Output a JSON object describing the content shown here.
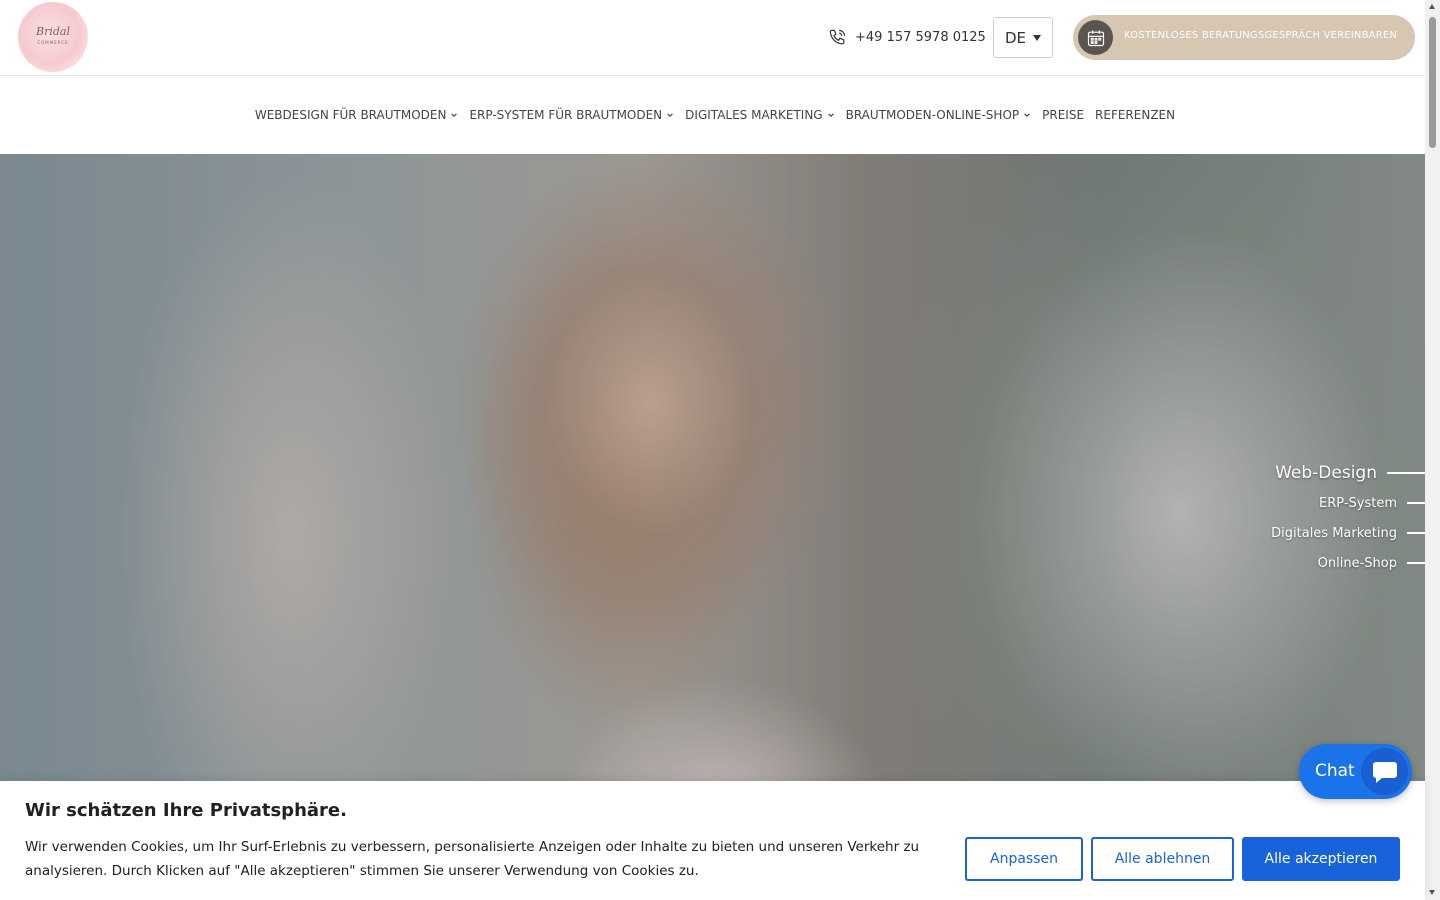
{
  "header": {
    "logo": {
      "script": "Bridal",
      "sub": "COMMERCE",
      "icon": "bridal-commerce-logo"
    },
    "phone": {
      "icon": "phone-icon",
      "number": "+49 157 5978 0125"
    },
    "language": {
      "selected": "DE"
    },
    "cta": {
      "icon": "calendar-icon",
      "label": "KOSTENLOSES BERATUNGSGESPRÄCH VEREINBAREN"
    }
  },
  "nav": {
    "items": [
      {
        "label": "WEBDESIGN FÜR BRAUTMODEN",
        "dropdown": true
      },
      {
        "label": "ERP-SYSTEM FÜR BRAUTMODEN",
        "dropdown": true
      },
      {
        "label": "DIGITALES MARKETING",
        "dropdown": true
      },
      {
        "label": "BRAUTMODEN-ONLINE-SHOP",
        "dropdown": true
      },
      {
        "label": "PREISE",
        "dropdown": false
      },
      {
        "label": "REFERENZEN",
        "dropdown": false
      }
    ]
  },
  "hero": {
    "side_nav": [
      {
        "label": "Web-Design",
        "active": true
      },
      {
        "label": "ERP-System",
        "active": false
      },
      {
        "label": "Digitales Marketing",
        "active": false
      },
      {
        "label": "Online-Shop",
        "active": false
      }
    ]
  },
  "chat": {
    "label": "Chat",
    "icon": "chat-bubble-icon"
  },
  "cookie": {
    "title": "Wir schätzen Ihre Privatsphäre.",
    "text": "Wir verwenden Cookies, um Ihr Surf-Erlebnis zu verbessern, personalisierte Anzeigen oder Inhalte zu bieten und unseren Verkehr zu analysieren. Durch Klicken auf \"Alle akzeptieren\" stimmen Sie unserer Verwendung von Cookies zu.",
    "buttons": {
      "customize": "Anpassen",
      "reject": "Alle ablehnen",
      "accept": "Alle akzeptieren"
    }
  },
  "colors": {
    "accent": "#1863dc",
    "cta_bg": "#d6c6b2",
    "chat_bg": "#1a73e8"
  }
}
